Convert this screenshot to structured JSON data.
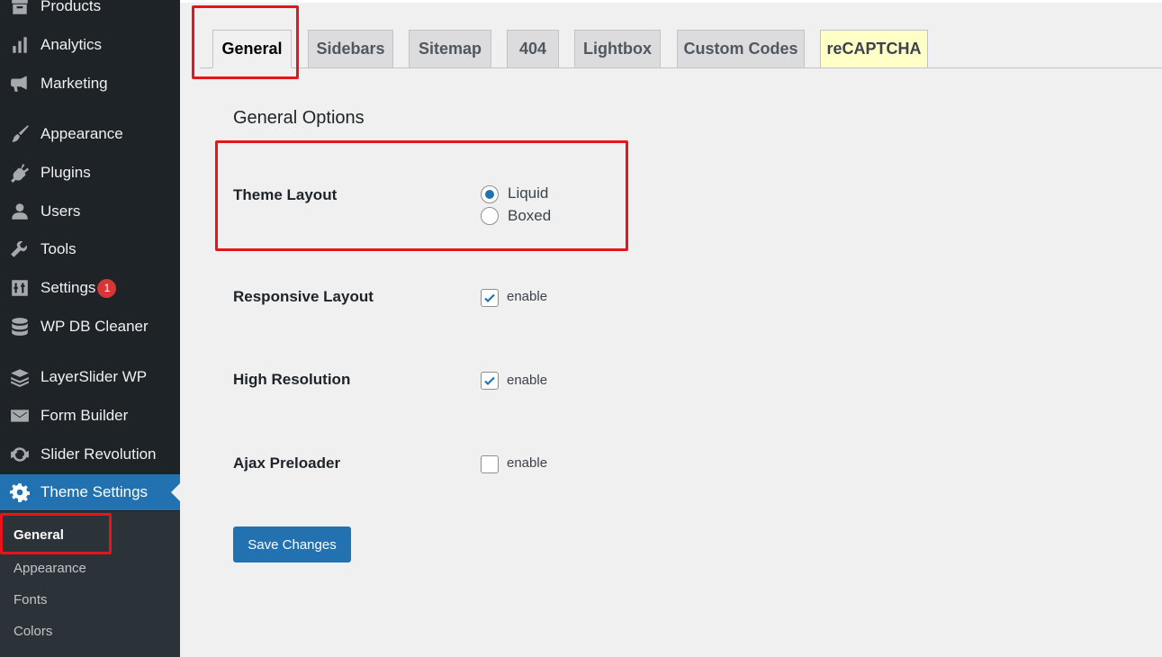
{
  "sidebar": {
    "items": [
      {
        "label": "Products",
        "icon": "archive-icon"
      },
      {
        "label": "Analytics",
        "icon": "bar-chart-icon"
      },
      {
        "label": "Marketing",
        "icon": "megaphone-icon"
      },
      {
        "label": "Appearance",
        "icon": "paintbrush-icon"
      },
      {
        "label": "Plugins",
        "icon": "plug-icon"
      },
      {
        "label": "Users",
        "icon": "user-icon"
      },
      {
        "label": "Tools",
        "icon": "wrench-icon"
      },
      {
        "label": "Settings",
        "icon": "sliders-icon",
        "badge": "1"
      },
      {
        "label": "WP DB Cleaner",
        "icon": "database-icon"
      },
      {
        "label": "LayerSlider WP",
        "icon": "layers-icon"
      },
      {
        "label": "Form Builder",
        "icon": "envelope-icon"
      },
      {
        "label": "Slider Revolution",
        "icon": "refresh-icon"
      },
      {
        "label": "Theme Settings",
        "icon": "gear-icon"
      }
    ],
    "submenu": [
      "General",
      "Appearance",
      "Fonts",
      "Colors"
    ]
  },
  "tabs": [
    "General",
    "Sidebars",
    "Sitemap",
    "404",
    "Lightbox",
    "Custom Codes",
    "reCAPTCHA"
  ],
  "main": {
    "heading": "General Options",
    "theme_layout": {
      "label": "Theme Layout",
      "options": [
        "Liquid",
        "Boxed"
      ],
      "selected": "Liquid"
    },
    "responsive_layout": {
      "label": "Responsive Layout",
      "option": "enable",
      "checked": true
    },
    "high_resolution": {
      "label": "High Resolution",
      "option": "enable",
      "checked": true
    },
    "ajax_preloader": {
      "label": "Ajax Preloader",
      "option": "enable",
      "checked": false
    },
    "save_label": "Save Changes"
  },
  "colors": {
    "sidebar_bg": "#1d2327",
    "accent": "#2271b1",
    "badge": "#d63638",
    "highlight": "#e8141b"
  }
}
